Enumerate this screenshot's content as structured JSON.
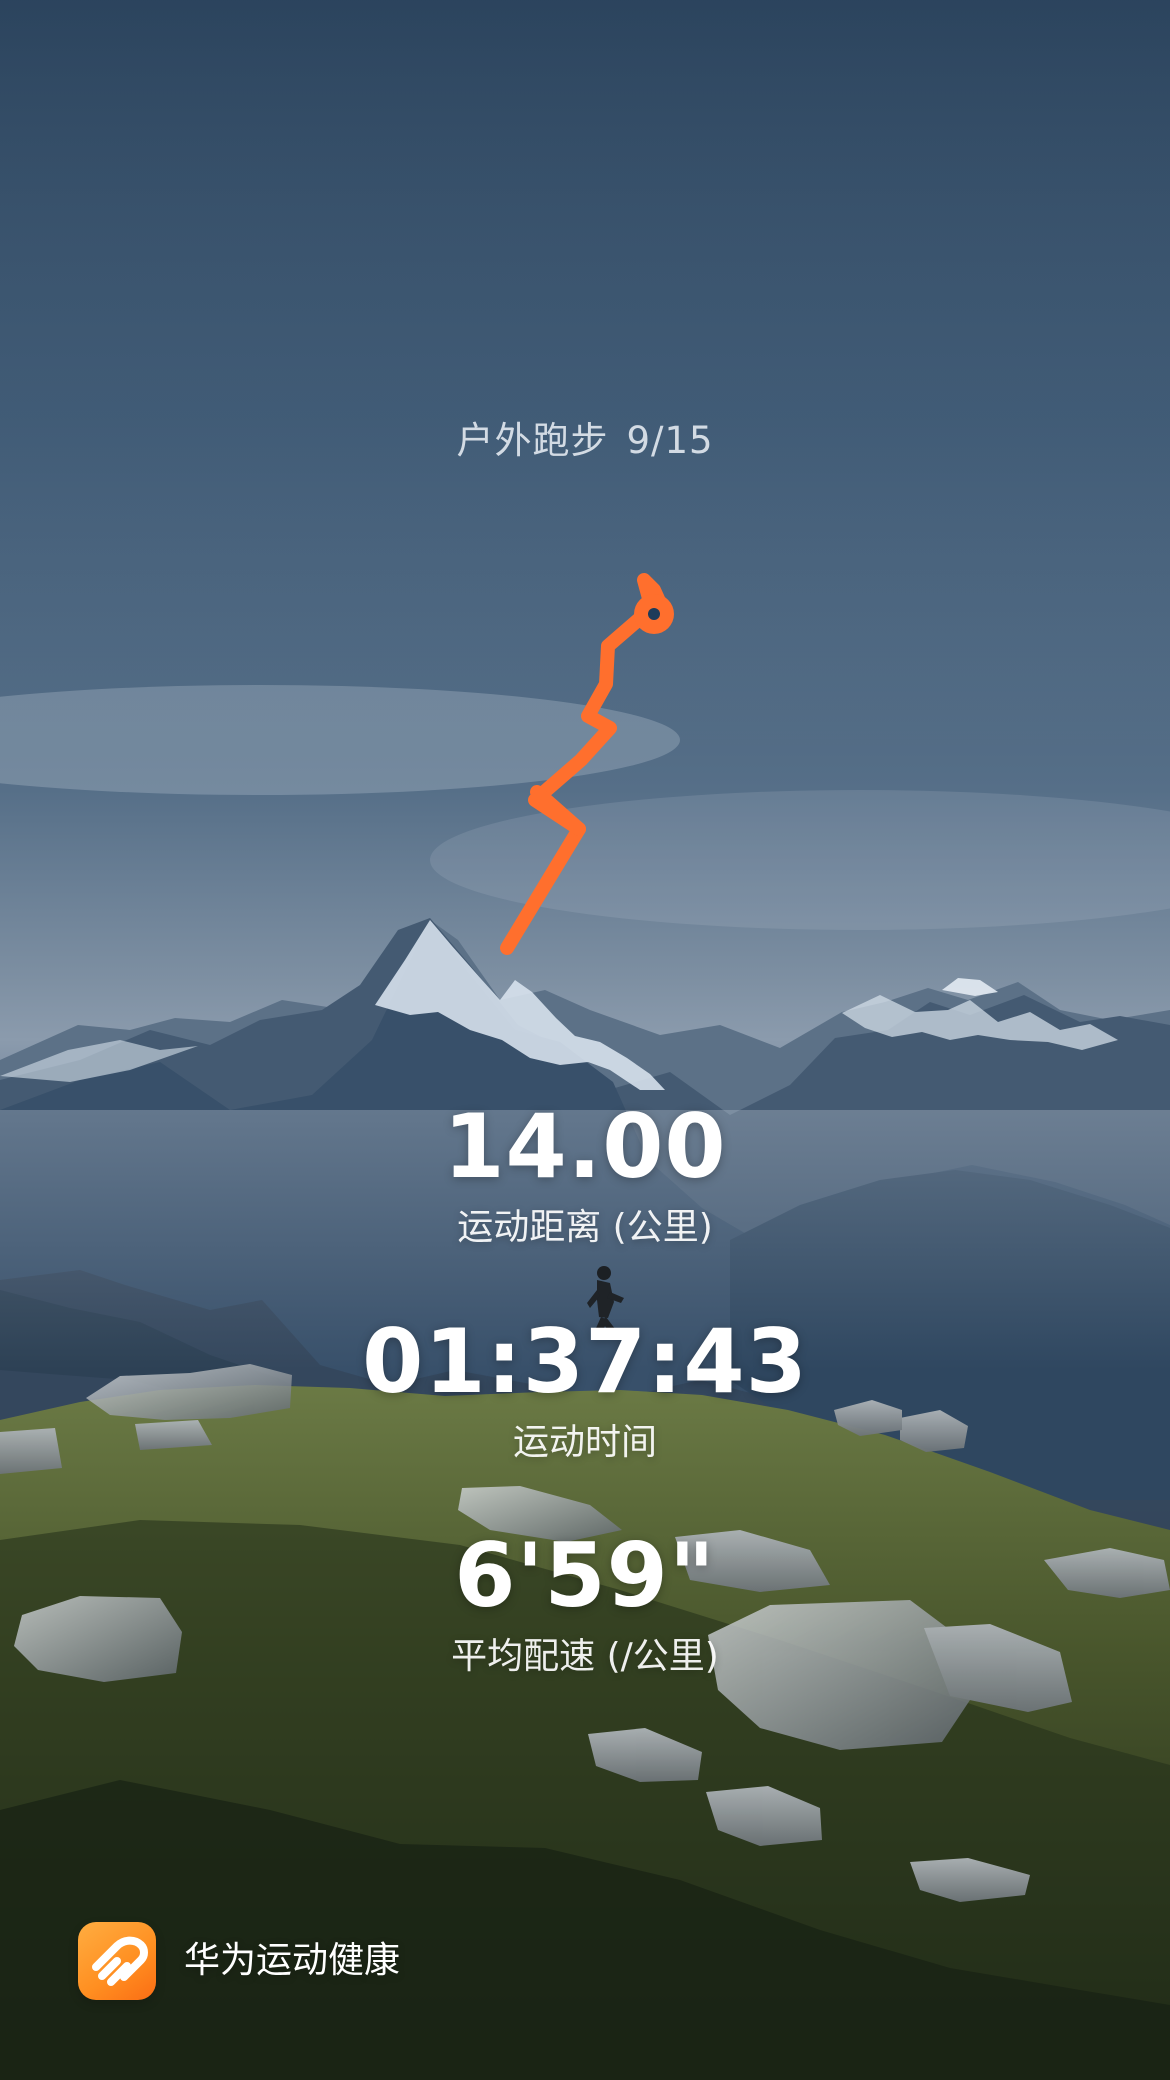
{
  "header": {
    "activity_type": "户外跑步",
    "date": "9/15"
  },
  "stats": {
    "distance": {
      "value": "14.00",
      "label": "运动距离 (公里)"
    },
    "duration": {
      "value": "01:37:43",
      "label": "运动时间"
    },
    "pace": {
      "value": "6'59\"",
      "label": "平均配速 (/公里)"
    }
  },
  "footer": {
    "brand_name": "华为运动健康",
    "icon": "huawei-health-logo"
  },
  "colors": {
    "route": "#ff6f2d",
    "brand_orange": "#ff8a1f"
  }
}
